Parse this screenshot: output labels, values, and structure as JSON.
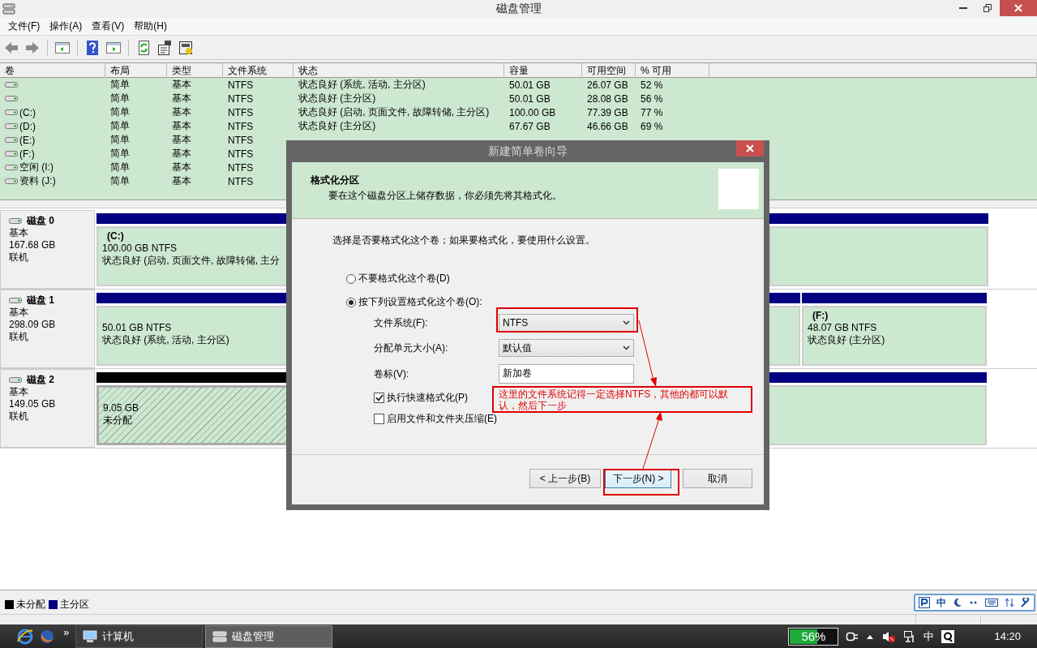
{
  "window": {
    "title": "磁盘管理"
  },
  "menu": [
    "文件(F)",
    "操作(A)",
    "查看(V)",
    "帮助(H)"
  ],
  "volume_table": {
    "columns": [
      "卷",
      "布局",
      "类型",
      "文件系统",
      "状态",
      "容量",
      "可用空间",
      "% 可用"
    ],
    "rows": [
      {
        "layout": "简单",
        "type": "基本",
        "file_system": "NTFS",
        "status": "状态良好 (系统, 活动, 主分区)",
        "capacity": "50.01 GB",
        "free_space": "26.07 GB",
        "percent_free": "52 %"
      },
      {
        "layout": "简单",
        "type": "基本",
        "file_system": "NTFS",
        "status": "状态良好 (主分区)",
        "capacity": "50.01 GB",
        "free_space": "28.08 GB",
        "percent_free": "56 %"
      },
      {
        "name": " (C:)",
        "layout": "简单",
        "type": "基本",
        "file_system": "NTFS",
        "status": "状态良好 (启动, 页面文件, 故障转储, 主分区)",
        "capacity": "100.00 GB",
        "free_space": "77.39 GB",
        "percent_free": "77 %"
      },
      {
        "name": " (D:)",
        "layout": "简单",
        "type": "基本",
        "file_system": "NTFS",
        "status": "状态良好 (主分区)",
        "capacity": "67.67 GB",
        "free_space": "46.66 GB",
        "percent_free": "69 %"
      },
      {
        "name": " (E:)",
        "layout": "简单",
        "type": "基本",
        "file_system": "NTFS"
      },
      {
        "name": " (F:)",
        "layout": "简单",
        "type": "基本",
        "file_system": "NTFS"
      },
      {
        "name": "空闲 (I:)",
        "layout": "简单",
        "type": "基本",
        "file_system": "NTFS"
      },
      {
        "name": "资料 (J:)",
        "layout": "简单",
        "type": "基本",
        "file_system": "NTFS"
      }
    ]
  },
  "disks": [
    {
      "name": "磁盘 0",
      "type": "基本",
      "size": "167.68 GB",
      "state": "联机",
      "partitions": [
        {
          "kind": "primary",
          "label": "(C:)",
          "size": "100.00 GB NTFS",
          "status": "状态良好 (启动, 页面文件, 故障转储, 主分"
        },
        {
          "kind": "primary"
        }
      ]
    },
    {
      "name": "磁盘 1",
      "type": "基本",
      "size": "298.09 GB",
      "state": "联机",
      "partitions": [
        {
          "kind": "primary",
          "size": "50.01 GB NTFS",
          "status": "状态良好 (系统, 活动, 主分区)"
        },
        {
          "kind": "primary"
        },
        {
          "kind": "primary",
          "label": "(F:)",
          "size": "48.07 GB NTFS",
          "status": "状态良好 (主分区)"
        }
      ]
    },
    {
      "name": "磁盘 2",
      "type": "基本",
      "size": "149.05 GB",
      "state": "联机",
      "partitions": [
        {
          "kind": "unallocated",
          "size": "9.05 GB",
          "status": "未分配"
        },
        {
          "kind": "primary"
        }
      ]
    }
  ],
  "legend": [
    {
      "label": "未分配",
      "color": "#000000"
    },
    {
      "label": "主分区",
      "color": "#000080"
    }
  ],
  "ime_bar": {
    "mode": "中"
  },
  "dialog": {
    "title": "新建简单卷向导",
    "heading": "格式化分区",
    "subheading": "要在这个磁盘分区上储存数据，你必须先将其格式化。",
    "prompt": "选择是否要格式化这个卷；如果要格式化，要使用什么设置。",
    "options": [
      {
        "label": "不要格式化这个卷(D)",
        "selected": false
      },
      {
        "label": "按下列设置格式化这个卷(O):",
        "selected": true
      }
    ],
    "fields": [
      {
        "kind": "dropdown",
        "label": "文件系统(F):",
        "value": "NTFS"
      },
      {
        "kind": "dropdown",
        "label": "分配单元大小(A):",
        "value": "默认值"
      },
      {
        "kind": "text",
        "label": "卷标(V):",
        "value": "新加卷"
      }
    ],
    "checkboxes": [
      {
        "label": "执行快速格式化(P)",
        "checked": true
      },
      {
        "label": "启用文件和文件夹压缩(E)",
        "checked": false
      }
    ],
    "buttons": [
      {
        "label": "< 上一步(B)",
        "kind": "normal"
      },
      {
        "label": "下一步(N) >",
        "kind": "default"
      },
      {
        "label": "取消",
        "kind": "normal"
      }
    ],
    "annotation": "这里的文件系统记得一定选择NTFS，其他的都可以默认，然后下一步"
  },
  "taskbar": {
    "overflow": "»",
    "tasks": [
      {
        "label": "计算机",
        "selected": false
      },
      {
        "label": "磁盘管理",
        "selected": true
      }
    ],
    "battery": "56%",
    "ime": "中",
    "clock": "14:20"
  }
}
